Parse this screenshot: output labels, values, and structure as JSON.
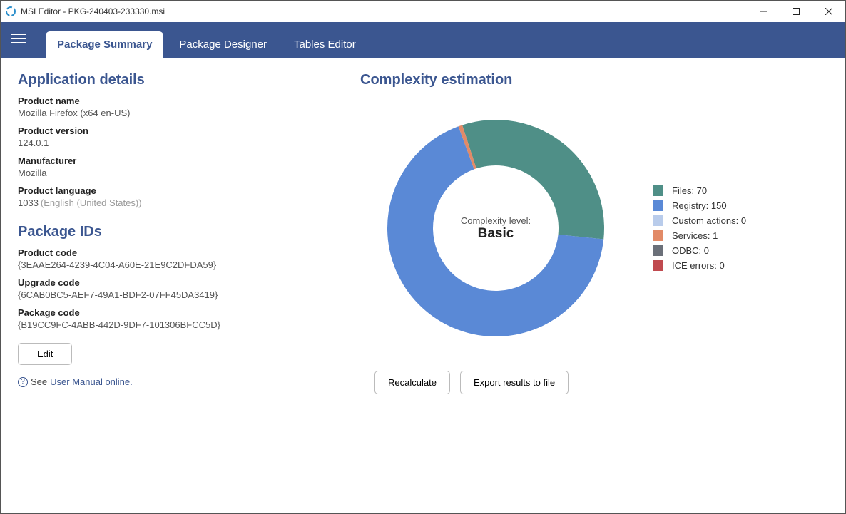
{
  "window": {
    "title": "MSI Editor - PKG-240403-233330.msi"
  },
  "topbar": {
    "tabs": [
      {
        "label": "Package Summary",
        "active": true
      },
      {
        "label": "Package Designer",
        "active": false
      },
      {
        "label": "Tables Editor",
        "active": false
      }
    ]
  },
  "left": {
    "app_details_heading": "Application details",
    "product_name": {
      "label": "Product name",
      "value": "Mozilla Firefox (x64 en-US)"
    },
    "product_version": {
      "label": "Product version",
      "value": "124.0.1"
    },
    "manufacturer": {
      "label": "Manufacturer",
      "value": "Mozilla"
    },
    "product_language": {
      "label": "Product language",
      "value": "1033",
      "extra": "(English (United States))"
    },
    "package_ids_heading": "Package IDs",
    "product_code": {
      "label": "Product code",
      "value": "{3EAAE264-4239-4C04-A60E-21E9C2DFDA59}"
    },
    "upgrade_code": {
      "label": "Upgrade code",
      "value": "{6CAB0BC5-AEF7-49A1-BDF2-07FF45DA3419}"
    },
    "package_code": {
      "label": "Package code",
      "value": "{B19CC9FC-4ABB-442D-9DF7-101306BFCC5D}"
    },
    "edit_label": "Edit",
    "help_prefix": "See ",
    "help_link": "User Manual online."
  },
  "right": {
    "heading": "Complexity estimation",
    "center_label": "Complexity level:",
    "center_value": "Basic",
    "recalc_label": "Recalculate",
    "export_label": "Export results to file"
  },
  "chart_data": {
    "type": "pie",
    "title": "Complexity estimation",
    "center_label": "Complexity level: Basic",
    "series": [
      {
        "name": "Files",
        "value": 70,
        "color": "#4f8f87",
        "legend": "Files: 70"
      },
      {
        "name": "Registry",
        "value": 150,
        "color": "#5a89d6",
        "legend": "Registry: 150"
      },
      {
        "name": "Custom actions",
        "value": 0,
        "color": "#b9cceb",
        "legend": "Custom actions: 0"
      },
      {
        "name": "Services",
        "value": 1,
        "color": "#e28a67",
        "legend": "Services: 1"
      },
      {
        "name": "ODBC",
        "value": 0,
        "color": "#6b7079",
        "legend": "ODBC: 0"
      },
      {
        "name": "ICE errors",
        "value": 0,
        "color": "#c04a4f",
        "legend": "ICE errors: 0"
      }
    ]
  }
}
